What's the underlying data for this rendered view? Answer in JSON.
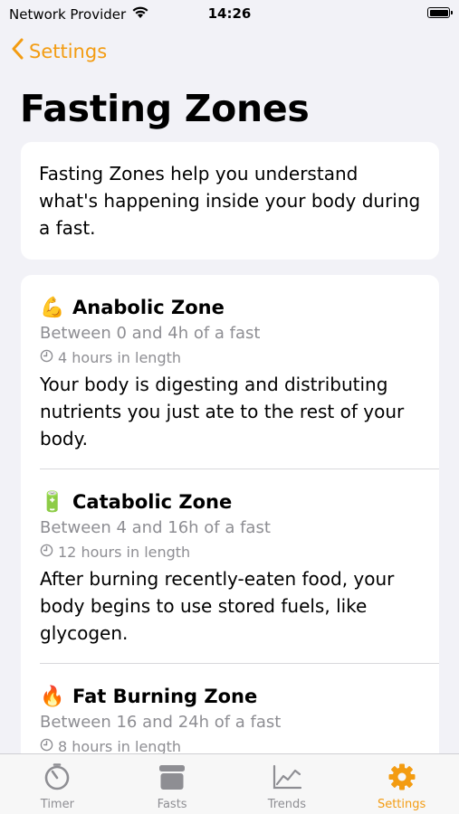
{
  "status_bar": {
    "carrier": "Network Provider",
    "time": "14:26",
    "battery_level": 1.0
  },
  "nav": {
    "back_label": "Settings",
    "back_icon": "chevron-left-icon"
  },
  "page": {
    "title": "Fasting Zones"
  },
  "intro": {
    "text": "Fasting Zones help you understand what's happening inside your body during a fast."
  },
  "zones": [
    {
      "emoji": "💪",
      "name": "Anabolic Zone",
      "range": "Between 0 and 4h of a fast",
      "length": "4 hours in length",
      "description": "Your body is digesting and distributing nutrients you just ate to the rest of your body."
    },
    {
      "emoji": "🔋",
      "name": "Catabolic Zone",
      "range": "Between 4 and 16h of a fast",
      "length": "12 hours in length",
      "description": "After burning recently-eaten food, your body begins to use stored fuels, like glycogen."
    },
    {
      "emoji": "🔥",
      "name": "Fat Burning Zone",
      "range": "Between 16 and 24h of a fast",
      "length": "8 hours in length",
      "description": ""
    }
  ],
  "tab_bar": {
    "tabs": [
      {
        "label": "Timer",
        "icon": "stopwatch-icon"
      },
      {
        "label": "Fasts",
        "icon": "archive-box-icon"
      },
      {
        "label": "Trends",
        "icon": "chart-icon"
      },
      {
        "label": "Settings",
        "icon": "gear-icon"
      }
    ],
    "active_index": 3
  },
  "colors": {
    "accent": "#f39c12",
    "secondary_text": "#8e8e93",
    "background": "#f2f2f7"
  }
}
